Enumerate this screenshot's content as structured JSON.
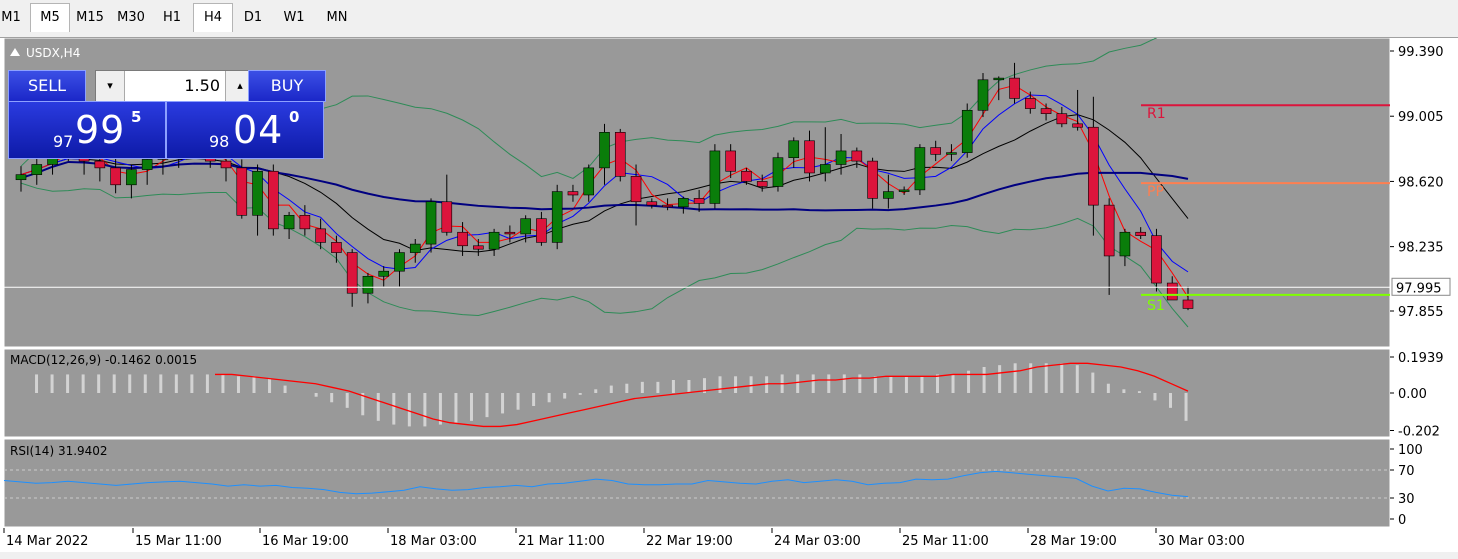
{
  "timeframes": [
    "M1",
    "M5",
    "M15",
    "M30",
    "H1",
    "H4",
    "D1",
    "W1",
    "MN"
  ],
  "active_timeframe": "H4",
  "symbol_label": "USDX,H4",
  "trade_panel": {
    "sell_label": "SELL",
    "buy_label": "BUY",
    "lot": "1.50",
    "sell_price_small": "97",
    "sell_price_big": "99",
    "sell_price_sup": "5",
    "buy_price_small": "98",
    "buy_price_big": "04",
    "buy_price_sup": "0",
    "down_arrow": "▾",
    "up_arrow": "▴"
  },
  "colors": {
    "chart_bg": "#999999",
    "bull": "#0a7d0a",
    "bear": "#dc143c",
    "ma_fast": "#ff0000",
    "ma_mid": "#0000ff",
    "ma_slow": "#000000",
    "ma_long": "#000080",
    "bollinger": "#2e8b57",
    "r1": "#dc143c",
    "pp": "#ff7f50",
    "s1": "#7fff00",
    "macd_signal": "#ff0000",
    "macd_hist": "#d3d3d3",
    "rsi": "#1e90ff"
  },
  "chart_data": {
    "type": "candlestick",
    "price_axis": [
      "99.390",
      "99.005",
      "98.620",
      "98.235",
      "97.855"
    ],
    "current_price_label": "97.995",
    "pivot_labels": {
      "r1": "R1",
      "pp": "PP",
      "s1": "S1"
    },
    "pivot_levels": {
      "r1": 99.07,
      "pp": 98.61,
      "s1": 97.95
    },
    "x_labels": [
      "14 Mar 2022",
      "15 Mar 11:00",
      "16 Mar 19:00",
      "18 Mar 03:00",
      "21 Mar 11:00",
      "22 Mar 19:00",
      "24 Mar 03:00",
      "25 Mar 11:00",
      "28 Mar 19:00",
      "30 Mar 03:00"
    ],
    "candles": [
      [
        98.63,
        98.71,
        98.56,
        98.66
      ],
      [
        98.66,
        98.77,
        98.6,
        98.72
      ],
      [
        98.72,
        98.88,
        98.66,
        98.8
      ],
      [
        98.8,
        98.92,
        98.74,
        98.84
      ],
      [
        98.84,
        98.9,
        98.66,
        98.74
      ],
      [
        98.74,
        98.82,
        98.62,
        98.7
      ],
      [
        98.7,
        98.76,
        98.55,
        98.6
      ],
      [
        98.6,
        98.72,
        98.52,
        98.69
      ],
      [
        98.69,
        98.8,
        98.6,
        98.75
      ],
      [
        98.75,
        98.84,
        98.66,
        98.78
      ],
      [
        98.78,
        98.9,
        98.7,
        98.86
      ],
      [
        98.86,
        98.96,
        98.78,
        98.8
      ],
      [
        98.8,
        98.88,
        98.7,
        98.74
      ],
      [
        98.74,
        98.8,
        98.62,
        98.7
      ],
      [
        98.7,
        98.75,
        98.4,
        98.42
      ],
      [
        98.42,
        98.72,
        98.3,
        98.68
      ],
      [
        98.68,
        98.72,
        98.3,
        98.34
      ],
      [
        98.34,
        98.44,
        98.28,
        98.42
      ],
      [
        98.42,
        98.48,
        98.3,
        98.34
      ],
      [
        98.34,
        98.4,
        98.22,
        98.26
      ],
      [
        98.26,
        98.3,
        98.14,
        98.2
      ],
      [
        98.2,
        98.22,
        97.88,
        97.96
      ],
      [
        97.96,
        98.08,
        97.9,
        98.06
      ],
      [
        98.06,
        98.12,
        98.0,
        98.09
      ],
      [
        98.09,
        98.22,
        98.0,
        98.2
      ],
      [
        98.2,
        98.28,
        98.14,
        98.25
      ],
      [
        98.25,
        98.52,
        98.2,
        98.5
      ],
      [
        98.5,
        98.66,
        98.3,
        98.32
      ],
      [
        98.32,
        98.38,
        98.18,
        98.24
      ],
      [
        98.24,
        98.28,
        98.18,
        98.22
      ],
      [
        98.22,
        98.34,
        98.18,
        98.32
      ],
      [
        98.32,
        98.36,
        98.26,
        98.31
      ],
      [
        98.31,
        98.42,
        98.26,
        98.4
      ],
      [
        98.4,
        98.44,
        98.24,
        98.26
      ],
      [
        98.26,
        98.6,
        98.22,
        98.56
      ],
      [
        98.56,
        98.6,
        98.5,
        98.54
      ],
      [
        98.54,
        98.72,
        98.5,
        98.7
      ],
      [
        98.7,
        98.96,
        98.6,
        98.91
      ],
      [
        98.91,
        98.93,
        98.62,
        98.65
      ],
      [
        98.65,
        98.72,
        98.36,
        98.5
      ],
      [
        98.5,
        98.52,
        98.46,
        98.48
      ],
      [
        98.48,
        98.52,
        98.45,
        98.47
      ],
      [
        98.47,
        98.53,
        98.43,
        98.52
      ],
      [
        98.52,
        98.57,
        98.44,
        98.49
      ],
      [
        98.49,
        98.84,
        98.46,
        98.8
      ],
      [
        98.8,
        98.84,
        98.64,
        98.68
      ],
      [
        98.68,
        98.7,
        98.6,
        98.62
      ],
      [
        98.62,
        98.66,
        98.56,
        98.59
      ],
      [
        98.59,
        98.79,
        98.56,
        98.76
      ],
      [
        98.76,
        98.88,
        98.7,
        98.86
      ],
      [
        98.86,
        98.92,
        98.62,
        98.67
      ],
      [
        98.67,
        98.94,
        98.62,
        98.72
      ],
      [
        98.72,
        98.9,
        98.66,
        98.8
      ],
      [
        98.8,
        98.82,
        98.7,
        98.74
      ],
      [
        98.74,
        98.76,
        98.46,
        98.52
      ],
      [
        98.52,
        98.66,
        98.46,
        98.56
      ],
      [
        98.56,
        98.59,
        98.54,
        98.57
      ],
      [
        98.57,
        98.84,
        98.54,
        98.82
      ],
      [
        98.82,
        98.86,
        98.74,
        98.78
      ],
      [
        98.78,
        98.84,
        98.74,
        98.79
      ],
      [
        98.79,
        99.08,
        98.76,
        99.04
      ],
      [
        99.04,
        99.26,
        99.0,
        99.22
      ],
      [
        99.22,
        99.24,
        99.1,
        99.23
      ],
      [
        99.23,
        99.32,
        99.08,
        99.11
      ],
      [
        99.11,
        99.15,
        99.02,
        99.05
      ],
      [
        99.05,
        99.08,
        98.98,
        99.02
      ],
      [
        99.02,
        99.06,
        98.94,
        98.96
      ],
      [
        98.96,
        99.16,
        98.92,
        98.94
      ],
      [
        98.94,
        99.12,
        98.3,
        98.48
      ],
      [
        98.48,
        98.52,
        97.95,
        98.18
      ],
      [
        98.18,
        98.34,
        98.12,
        98.32
      ],
      [
        98.32,
        98.35,
        98.28,
        98.3
      ],
      [
        98.3,
        98.34,
        97.97,
        98.02
      ],
      [
        98.02,
        98.06,
        97.94,
        97.92
      ],
      [
        97.92,
        98.0,
        97.86,
        97.87
      ]
    ],
    "macd_label": "MACD(12,26,9) -0.1462 0.0015",
    "macd_axis": [
      "0.1939",
      "0.00",
      "-0.202"
    ],
    "macd_hist": [
      0.1,
      0.1,
      0.1,
      0.1,
      0.1,
      0.1,
      0.1,
      0.1,
      0.1,
      0.1,
      0.1,
      0.1,
      0.1,
      0.09,
      0.09,
      0.08,
      0.04,
      0.0,
      -0.02,
      -0.05,
      -0.08,
      -0.12,
      -0.15,
      -0.17,
      -0.18,
      -0.18,
      -0.17,
      -0.16,
      -0.15,
      -0.13,
      -0.11,
      -0.09,
      -0.07,
      -0.05,
      -0.03,
      -0.01,
      0.02,
      0.04,
      0.05,
      0.06,
      0.06,
      0.07,
      0.07,
      0.08,
      0.09,
      0.09,
      0.09,
      0.09,
      0.1,
      0.1,
      0.1,
      0.1,
      0.1,
      0.1,
      0.09,
      0.09,
      0.09,
      0.09,
      0.1,
      0.1,
      0.12,
      0.14,
      0.15,
      0.16,
      0.16,
      0.16,
      0.16,
      0.15,
      0.11,
      0.05,
      0.02,
      0.01,
      -0.04,
      -0.08,
      -0.15
    ],
    "macd_signal": [
      0.1,
      0.1,
      0.09,
      0.08,
      0.07,
      0.06,
      0.05,
      0.03,
      0.01,
      -0.02,
      -0.05,
      -0.08,
      -0.11,
      -0.14,
      -0.16,
      -0.17,
      -0.18,
      -0.18,
      -0.17,
      -0.15,
      -0.13,
      -0.11,
      -0.09,
      -0.07,
      -0.05,
      -0.03,
      -0.02,
      -0.01,
      0.0,
      0.01,
      0.02,
      0.03,
      0.04,
      0.05,
      0.05,
      0.06,
      0.07,
      0.07,
      0.08,
      0.08,
      0.09,
      0.09,
      0.09,
      0.09,
      0.1,
      0.1,
      0.1,
      0.11,
      0.12,
      0.14,
      0.15,
      0.16,
      0.16,
      0.15,
      0.14,
      0.12,
      0.09,
      0.05,
      0.01
    ],
    "rsi_label": "RSI(14) 31.9402",
    "rsi_axis": [
      "100",
      "70",
      "30",
      "0"
    ],
    "rsi_values": [
      55,
      53,
      51,
      52,
      54,
      52,
      50,
      48,
      50,
      52,
      53,
      54,
      52,
      50,
      47,
      49,
      47,
      48,
      45,
      44,
      42,
      38,
      36,
      37,
      39,
      41,
      46,
      43,
      41,
      42,
      45,
      46,
      48,
      46,
      50,
      51,
      54,
      57,
      55,
      50,
      49,
      49,
      50,
      50,
      55,
      53,
      51,
      50,
      54,
      56,
      52,
      54,
      56,
      54,
      49,
      51,
      52,
      57,
      56,
      57,
      62,
      66,
      68,
      66,
      64,
      62,
      60,
      58,
      47,
      40,
      44,
      43,
      38,
      34,
      32
    ]
  }
}
